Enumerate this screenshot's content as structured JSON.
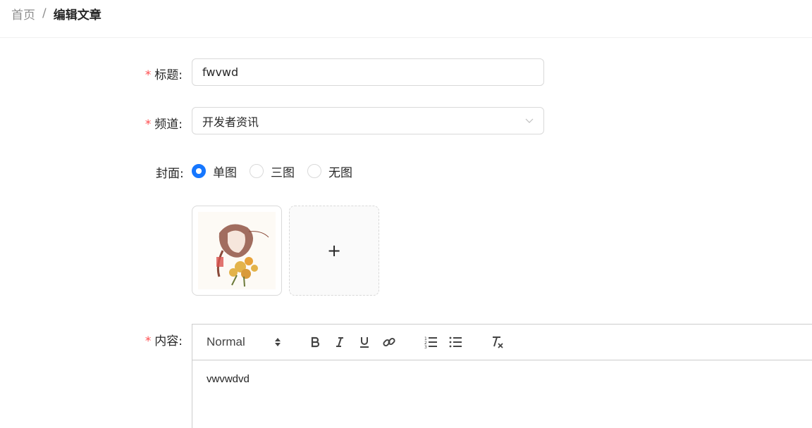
{
  "breadcrumb": {
    "home": "首页",
    "separator": "/",
    "current": "编辑文章"
  },
  "form": {
    "required_mark": "*",
    "title": {
      "label": "标题:",
      "value": "fwvwd"
    },
    "channel": {
      "label": "频道:",
      "value": "开发者资讯"
    },
    "cover": {
      "label": "封面:",
      "options": [
        "单图",
        "三图",
        "无图"
      ],
      "selected": "单图"
    },
    "upload": {
      "add_symbol": "+"
    },
    "content": {
      "label": "内容:",
      "header_picker": "Normal",
      "body": "vwvwdvd"
    }
  },
  "colors": {
    "primary": "#1677ff",
    "required": "#ff4d4f",
    "border": "#d9d9d9"
  },
  "icons": [
    "chevron-down-icon",
    "bold-icon",
    "italic-icon",
    "underline-icon",
    "link-icon",
    "ordered-list-icon",
    "bullet-list-icon",
    "clear-format-icon",
    "plus-icon"
  ]
}
